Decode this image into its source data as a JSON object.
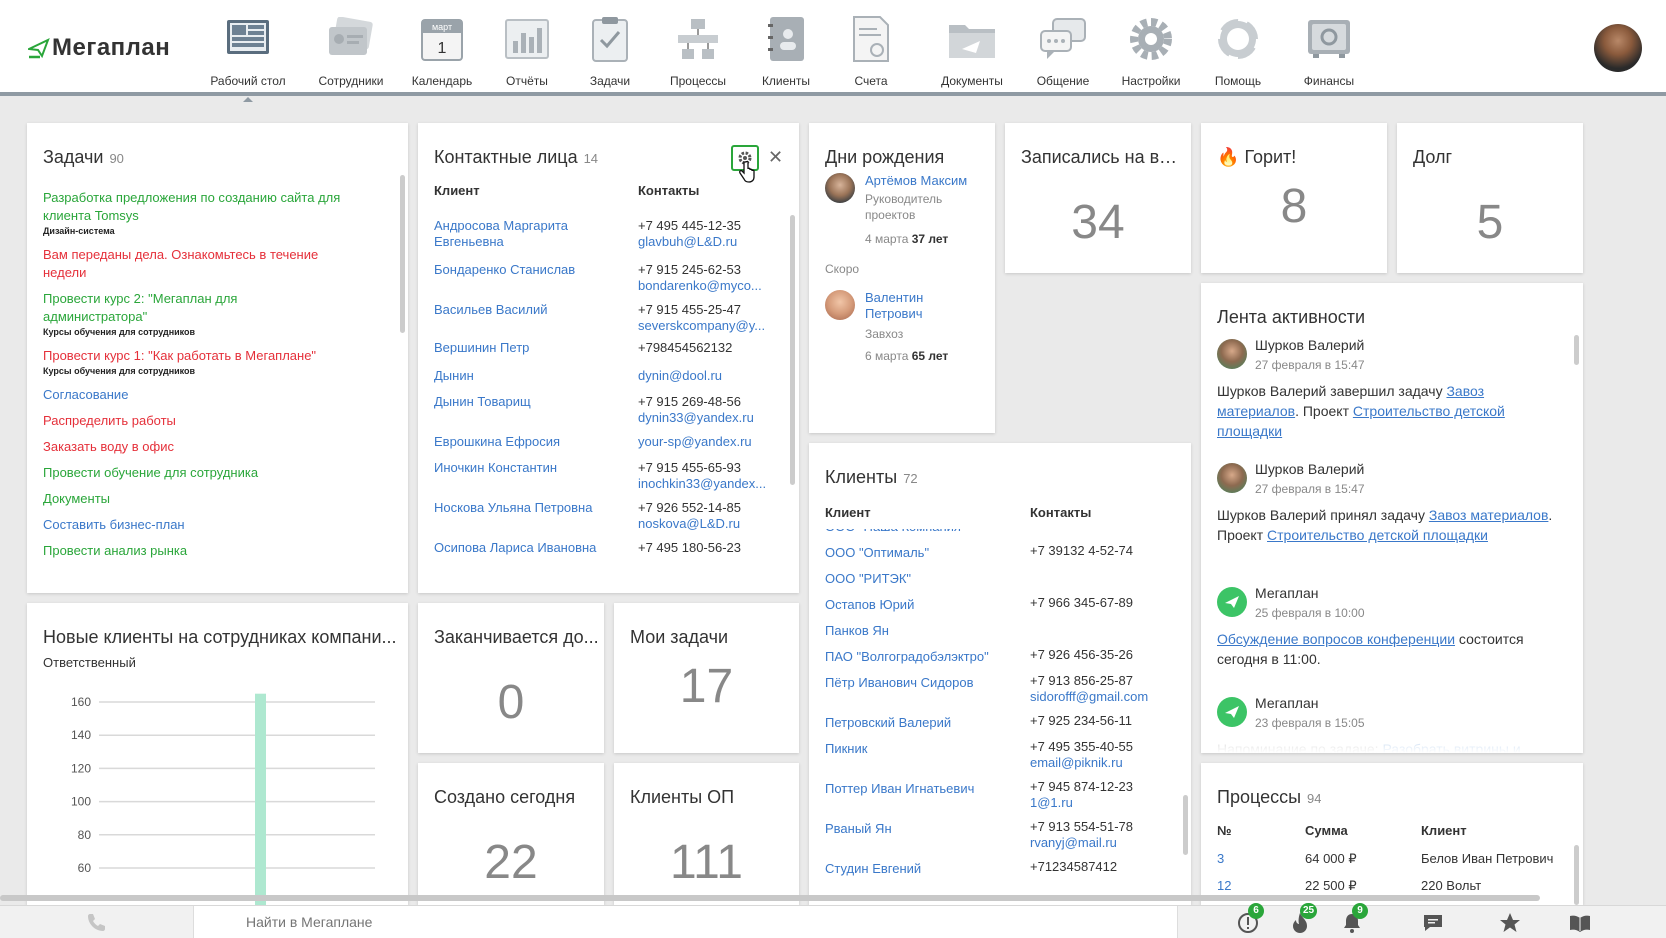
{
  "logo": {
    "text": "Мегаплан"
  },
  "nav": [
    {
      "label": "Рабочий стол",
      "icon": "desktop-icon",
      "active": true
    },
    {
      "label": "Сотрудники",
      "icon": "employees-icon"
    },
    {
      "label": "Календарь",
      "icon": "calendar-icon",
      "month": "март",
      "day": "1"
    },
    {
      "label": "Отчёты",
      "icon": "reports-icon"
    },
    {
      "label": "Задачи",
      "icon": "tasks-icon"
    },
    {
      "label": "Процессы",
      "icon": "processes-icon"
    },
    {
      "label": "Клиенты",
      "icon": "clients-icon"
    },
    {
      "label": "Счета",
      "icon": "invoices-icon"
    },
    {
      "label": "Документы",
      "icon": "documents-icon"
    },
    {
      "label": "Общение",
      "icon": "chat-icon"
    },
    {
      "label": "Настройки",
      "icon": "settings-icon"
    },
    {
      "label": "Помощь",
      "icon": "help-icon"
    },
    {
      "label": "Финансы",
      "icon": "finance-icon"
    }
  ],
  "tasks_widget": {
    "title": "Задачи",
    "count": "90",
    "items": [
      {
        "text": "Разработка предложения по созданию сайта для клиента Tomsys",
        "sub": "Дизайн-система",
        "color": "green"
      },
      {
        "text": "Вам переданы дела. Ознакомьтесь в течение недели",
        "sub": "",
        "color": "red"
      },
      {
        "text": "Провести курс 2: \"Мегаплан для администратора\"",
        "sub": "Курсы обучения для сотрудников",
        "color": "green"
      },
      {
        "text": "Провести курс 1: \"Как работать в Мегаплане\"",
        "sub": "Курсы обучения для сотрудников",
        "color": "red"
      },
      {
        "text": "Согласование",
        "sub": "",
        "color": "blue"
      },
      {
        "text": "Распределить работы",
        "sub": "",
        "color": "red"
      },
      {
        "text": "Заказать воду в офис",
        "sub": "",
        "color": "red"
      },
      {
        "text": "Провести обучение для сотрудника",
        "sub": "",
        "color": "green"
      },
      {
        "text": "Документы",
        "sub": "",
        "color": "green"
      },
      {
        "text": "Составить бизнес-план",
        "sub": "",
        "color": "blue"
      },
      {
        "text": "Провести анализ рынка",
        "sub": "",
        "color": "green"
      }
    ]
  },
  "contacts_widget": {
    "title": "Контактные лица",
    "count": "14",
    "col_client": "Клиент",
    "col_contacts": "Контакты",
    "rows": [
      {
        "name": "Андросова Маргарита Евгеньевна",
        "phone": "+7 495 445-12-35",
        "email": "glavbuh@L&D.ru"
      },
      {
        "name": "Бондаренко Станислав",
        "phone": "+7 915 245-62-53",
        "email": "bondarenko@myco..."
      },
      {
        "name": "Васильев Василий",
        "phone": "+7 915 455-25-47",
        "email": "severskcompany@y..."
      },
      {
        "name": "Вершинин Петр",
        "phone": "+798454562132",
        "email": ""
      },
      {
        "name": "Дынин",
        "phone": "",
        "email": "dynin@dool.ru"
      },
      {
        "name": "Дынин Товарищ",
        "phone": "+7 915 269-48-56",
        "email": "dynin33@yandex.ru"
      },
      {
        "name": "Еврошкина Ефросия",
        "phone": "",
        "email": "your-sp@yandex.ru"
      },
      {
        "name": "Иночкин Константин",
        "phone": "+7 915 455-65-93",
        "email": "inochkin33@yandex..."
      },
      {
        "name": "Носкова Ульяна Петровна",
        "phone": "+7 926 552-14-85",
        "email": "noskova@L&D.ru"
      },
      {
        "name": "Осипова Лариса Ивановна",
        "phone": "+7 495 180-56-23",
        "email": ""
      }
    ]
  },
  "birthdays_widget": {
    "title": "Дни рождения",
    "today": {
      "name": "Артёмов Максим",
      "role": "Руководитель проектов",
      "date": "4 марта",
      "age": "37 лет"
    },
    "soon_label": "Скоро",
    "soon": {
      "name": "Валентин Петрович",
      "role": "Завхоз",
      "date": "6 марта",
      "age": "65 лет"
    }
  },
  "webinar_widget": {
    "title": "Записались на ве...",
    "value": "34"
  },
  "hot_widget": {
    "title": "Горит!",
    "value": "8"
  },
  "debt_widget": {
    "title": "Долг",
    "value": "5"
  },
  "activity_widget": {
    "title": "Лента активности",
    "items": [
      {
        "who": "Шурков Валерий",
        "when": "27 февраля в 15:47",
        "avatar": "person",
        "parts": [
          {
            "t": "Шурков Валерий завершил задачу "
          },
          {
            "t": "Завоз материалов",
            "link": true
          },
          {
            "t": ". Проект "
          },
          {
            "t": "Строительство детской площадки",
            "link": true
          }
        ]
      },
      {
        "who": "Шурков Валерий",
        "when": "27 февраля в 15:47",
        "avatar": "person",
        "parts": [
          {
            "t": "Шурков Валерий принял задачу "
          },
          {
            "t": "Завоз материалов",
            "link": true
          },
          {
            "t": ". Проект "
          },
          {
            "t": "Строительство детской площадки",
            "link": true
          }
        ]
      },
      {
        "who": "Мегаплан",
        "when": "25 февраля в 10:00",
        "avatar": "megaplan",
        "parts": [
          {
            "t": "Обсуждение вопросов конференции",
            "link": true
          },
          {
            "t": " состоится сегодня в 11:00."
          }
        ]
      },
      {
        "who": "Мегаплан",
        "when": "23 февраля в 15:05",
        "avatar": "megaplan",
        "parts": [
          {
            "t": "Напоминание по задаче: "
          },
          {
            "t": "Разобрать витрины и",
            "link": true
          }
        ]
      }
    ]
  },
  "clients_widget": {
    "title": "Клиенты",
    "count": "72",
    "col_client": "Клиент",
    "col_contacts": "Контакты",
    "rows": [
      {
        "name": "ООО \"Наша Компания\"",
        "phone": "",
        "email": ""
      },
      {
        "name": "ООО \"Оптималь\"",
        "phone": "+7 39132 4-52-74",
        "email": ""
      },
      {
        "name": "ООО \"РИТЭК\"",
        "phone": "",
        "email": ""
      },
      {
        "name": "Остапов Юрий",
        "phone": "+7 966 345-67-89",
        "email": ""
      },
      {
        "name": "Панков Ян",
        "phone": "",
        "email": ""
      },
      {
        "name": "ПАО \"Волгоградобэлэктро\"",
        "phone": "+7 926 456-35-26",
        "email": ""
      },
      {
        "name": "Пётр Иванович Сидоров",
        "phone": "+7 913 856-25-87",
        "email": "sidorofff@gmail.com"
      },
      {
        "name": "Петровский Валерий",
        "phone": "+7 925 234-56-11",
        "email": ""
      },
      {
        "name": "Пикник",
        "phone": "+7 495 355-40-55",
        "email": "email@piknik.ru"
      },
      {
        "name": "Поттер Иван Игнатьевич",
        "phone": "+7 945 874-12-23",
        "email": "1@1.ru"
      },
      {
        "name": "Рваный Ян",
        "phone": "+7 913 554-51-78",
        "email": "rvanyj@mail.ru"
      },
      {
        "name": "Студин Евгений",
        "phone": "+71234587412",
        "email": ""
      }
    ]
  },
  "newclients_widget": {
    "title": "Новые клиенты на сотрудниках компани...",
    "subtitle": "Ответственный",
    "chart_data": {
      "type": "bar",
      "title": "Новые клиенты на сотрудниках компании",
      "xlabel": "Ответственный",
      "ylabel": "",
      "yticks": [
        60,
        80,
        100,
        120,
        140,
        160
      ],
      "ylim": [
        60,
        160
      ],
      "categories": [
        ""
      ],
      "values": [
        165
      ],
      "bar_color": "#aee8d0"
    }
  },
  "ending_widget": {
    "title": "Заканчивается до...",
    "value": "0"
  },
  "mytasks_widget": {
    "title": "Мои задачи",
    "value": "17"
  },
  "created_widget": {
    "title": "Создано сегодня",
    "value": "22"
  },
  "clientsop_widget": {
    "title": "Клиенты ОП",
    "value": "111"
  },
  "processes_widget": {
    "title": "Процессы",
    "count": "94",
    "col_num": "№",
    "col_sum": "Сумма",
    "col_client": "Клиент",
    "rows": [
      {
        "num": "3",
        "sum": "64 000 ₽",
        "client": "Белов Иван Петрович"
      },
      {
        "num": "12",
        "sum": "22 500 ₽",
        "client": "220 Вольт"
      }
    ]
  },
  "footer": {
    "search_placeholder": "Найти в Мегаплане",
    "badges": {
      "alerts": "6",
      "hot": "25",
      "notifications": "9"
    }
  },
  "colors": {
    "accent_green": "#2aa63a",
    "link_blue": "#3a78c9",
    "danger_red": "#e5303a"
  }
}
